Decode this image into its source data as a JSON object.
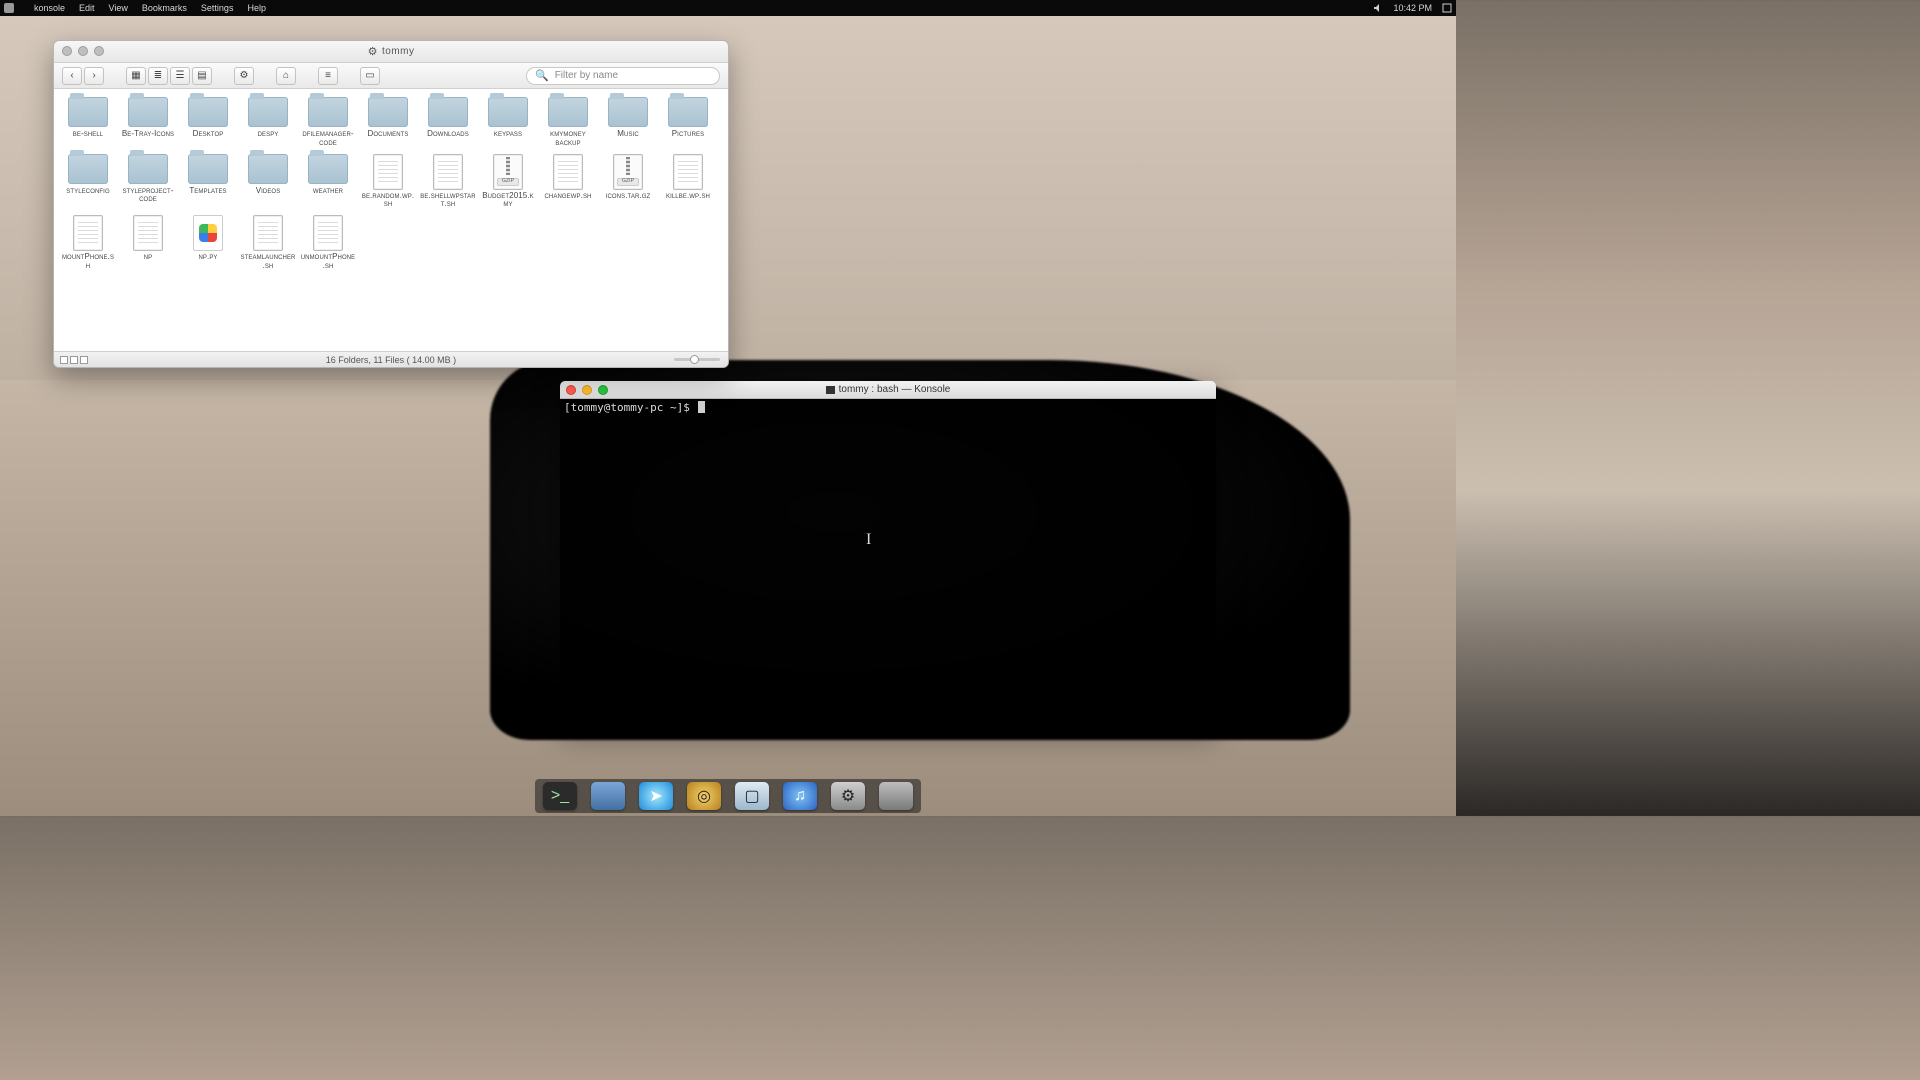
{
  "menubar": {
    "app": "konsole",
    "items": [
      "Edit",
      "View",
      "Bookmarks",
      "Settings",
      "Help"
    ],
    "clock": "10:42 PM",
    "tray_icons": [
      "volume-icon",
      "menu-icon"
    ]
  },
  "file_manager": {
    "title": "tommy",
    "search_placeholder": "Filter by name",
    "status": "16 Folders, 11 Files ( 14.00 MB )",
    "toolbar": {
      "back": "‹",
      "fwd": "›",
      "view_icons": "▦",
      "view_list": "≣",
      "view_cols": "☰",
      "view_comp": "▤",
      "gear": "⚙",
      "home": "⌂",
      "sort": "≡",
      "newtab": "▭"
    },
    "items": [
      {
        "type": "folder",
        "label": "be-shell"
      },
      {
        "type": "folder",
        "label": "Be-Tray-Icons"
      },
      {
        "type": "folder",
        "label": "Desktop"
      },
      {
        "type": "folder",
        "label": "despy"
      },
      {
        "type": "folder",
        "label": "dfilemanager-code"
      },
      {
        "type": "folder",
        "label": "Documents"
      },
      {
        "type": "folder",
        "label": "Downloads"
      },
      {
        "type": "folder",
        "label": "keypass"
      },
      {
        "type": "folder",
        "label": "kmymoney backup"
      },
      {
        "type": "folder",
        "label": "Music"
      },
      {
        "type": "folder",
        "label": "Pictures"
      },
      {
        "type": "folder",
        "label": "styleconfig"
      },
      {
        "type": "folder",
        "label": "styleproject-code"
      },
      {
        "type": "folder",
        "label": "Templates"
      },
      {
        "type": "folder",
        "label": "Videos"
      },
      {
        "type": "folder",
        "label": "weather"
      },
      {
        "type": "text",
        "label": "be.random.wp.sh"
      },
      {
        "type": "text",
        "label": "be.shellwpstart.sh"
      },
      {
        "type": "gzip",
        "label": "Budget2015.kmy",
        "tag": "GZIP"
      },
      {
        "type": "text",
        "label": "changewp.sh"
      },
      {
        "type": "gzip",
        "label": "icons.tar.gz",
        "tag": "GZIP"
      },
      {
        "type": "text",
        "label": "killbe.wp.sh"
      },
      {
        "type": "text",
        "label": "mountPhone.sh"
      },
      {
        "type": "text",
        "label": "np"
      },
      {
        "type": "py",
        "label": "np.py"
      },
      {
        "type": "text",
        "label": "steamlauncher.sh"
      },
      {
        "type": "text",
        "label": "unmountPhone.sh"
      }
    ]
  },
  "terminal": {
    "title": "tommy : bash — Konsole",
    "prompt": "[tommy@tommy-pc ~]$ "
  },
  "dock": {
    "apps": [
      {
        "name": "terminal-app",
        "glyph": ">_"
      },
      {
        "name": "finder-app",
        "glyph": ""
      },
      {
        "name": "web-app",
        "glyph": "➤"
      },
      {
        "name": "coin-app",
        "glyph": "◎"
      },
      {
        "name": "monitor-app",
        "glyph": "▢"
      },
      {
        "name": "music-app",
        "glyph": "♫"
      },
      {
        "name": "settings-app",
        "glyph": "⚙"
      },
      {
        "name": "app8",
        "glyph": ""
      }
    ]
  }
}
